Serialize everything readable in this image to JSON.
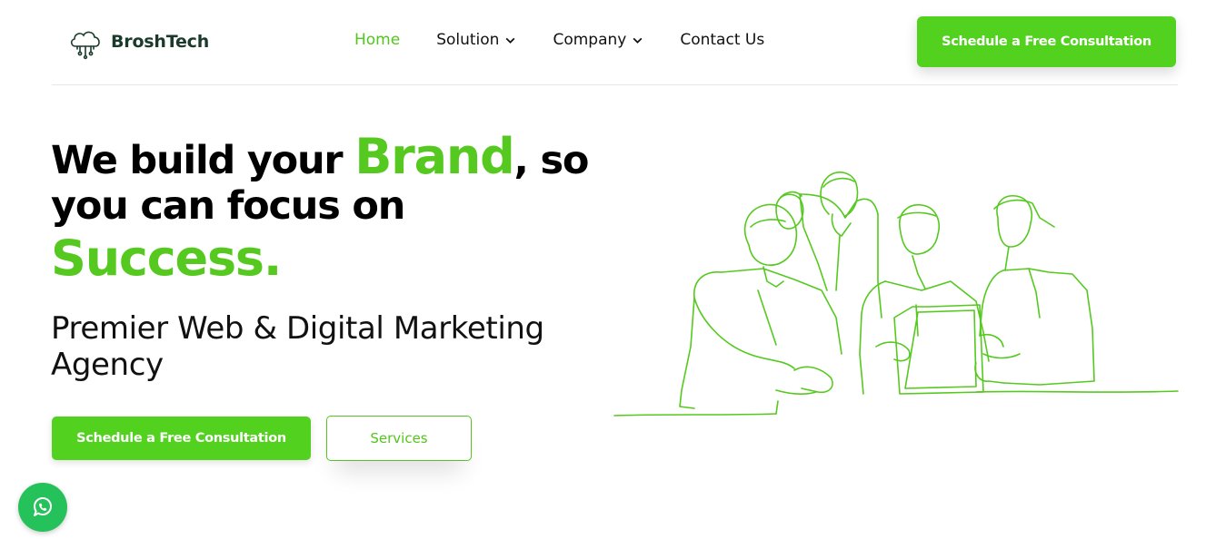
{
  "brand": {
    "name": "BroshTech",
    "logo_icon": "cloud-circuit-icon"
  },
  "nav": {
    "items": [
      {
        "label": "Home",
        "active": true,
        "dropdown": false
      },
      {
        "label": "Solution",
        "active": false,
        "dropdown": true
      },
      {
        "label": "Company",
        "active": false,
        "dropdown": true
      },
      {
        "label": "Contact Us",
        "active": false,
        "dropdown": false
      }
    ],
    "cta_label": "Schedule a Free Consultation"
  },
  "hero": {
    "title_part1": "We build your ",
    "title_highlight": "Brand",
    "title_part2": ", so you can focus on",
    "title_success": "Success.",
    "subtitle": "Premier Web & Digital Marketing Agency",
    "primary_button": "Schedule a Free Consultation",
    "secondary_button": "Services",
    "illustration": "team-line-art-illustration"
  },
  "floating": {
    "whatsapp_icon": "whatsapp-icon"
  },
  "colors": {
    "accent": "#52d11f",
    "dark_brand": "#1b3b2a",
    "text": "#111111"
  }
}
